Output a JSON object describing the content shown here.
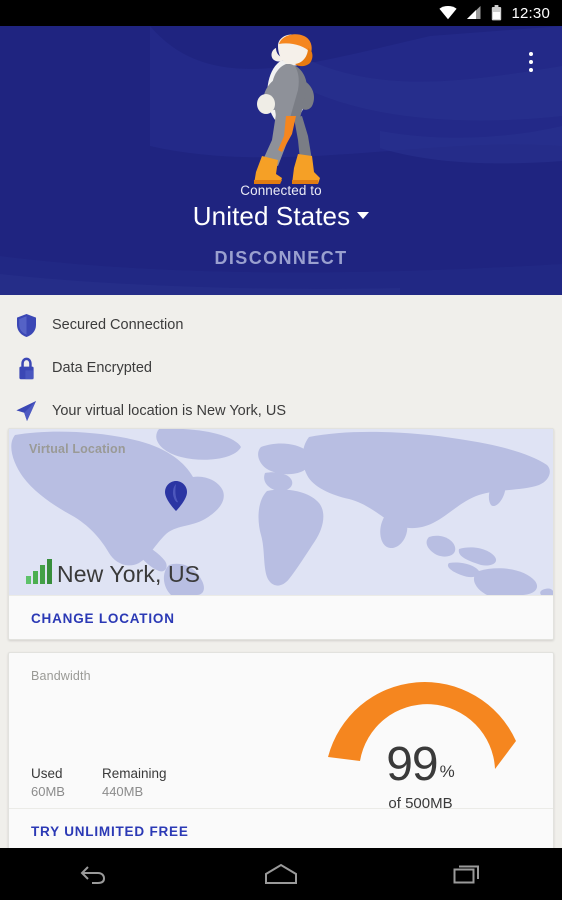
{
  "statusbar": {
    "time": "12:30",
    "icons": [
      "wifi-icon",
      "cellular-signal-icon",
      "battery-icon"
    ]
  },
  "header": {
    "overflow_menu": "overflow-menu-icon",
    "mascot": "vpn-superhero-mascot",
    "connected_label": "Connected to",
    "country": "United States",
    "country_caret": "chevron-down-icon",
    "disconnect_label": "DISCONNECT",
    "bg_color": "#1F2480"
  },
  "status_list": [
    {
      "icon": "shield-icon",
      "text": "Secured Connection"
    },
    {
      "icon": "lock-icon",
      "text": "Data Encrypted"
    },
    {
      "icon": "navigation-arrow-icon",
      "text": "Your virtual location is New York, US"
    }
  ],
  "location_card": {
    "label": "Virtual Location",
    "pin_icon": "map-pin-icon",
    "signal_icon": "signal-bars-icon",
    "city": "New York, US",
    "action_label": "CHANGE LOCATION",
    "action_color": "#2B39B5",
    "map_land_color": "#B8BEE2",
    "map_ocean_color": "#DFE3F4"
  },
  "bandwidth_card": {
    "label": "Bandwidth",
    "used_label": "Used",
    "used_value": "60MB",
    "remaining_label": "Remaining",
    "remaining_value": "440MB",
    "percent": "99",
    "percent_symbol": "%",
    "total_label": "of 500MB",
    "gauge_color": "#F5861F",
    "action_label": "TRY UNLIMITED FREE",
    "action_color": "#2B39B5"
  },
  "navbar": {
    "back": "back-icon",
    "home": "home-icon",
    "recents": "recents-icon"
  },
  "chart_data": {
    "type": "gauge",
    "title": "Bandwidth",
    "value": 99,
    "unit": "%",
    "total": 500,
    "total_unit": "MB",
    "used": 60,
    "remaining": 440,
    "arc_color": "#F5861F",
    "ylim": [
      0,
      100
    ]
  }
}
